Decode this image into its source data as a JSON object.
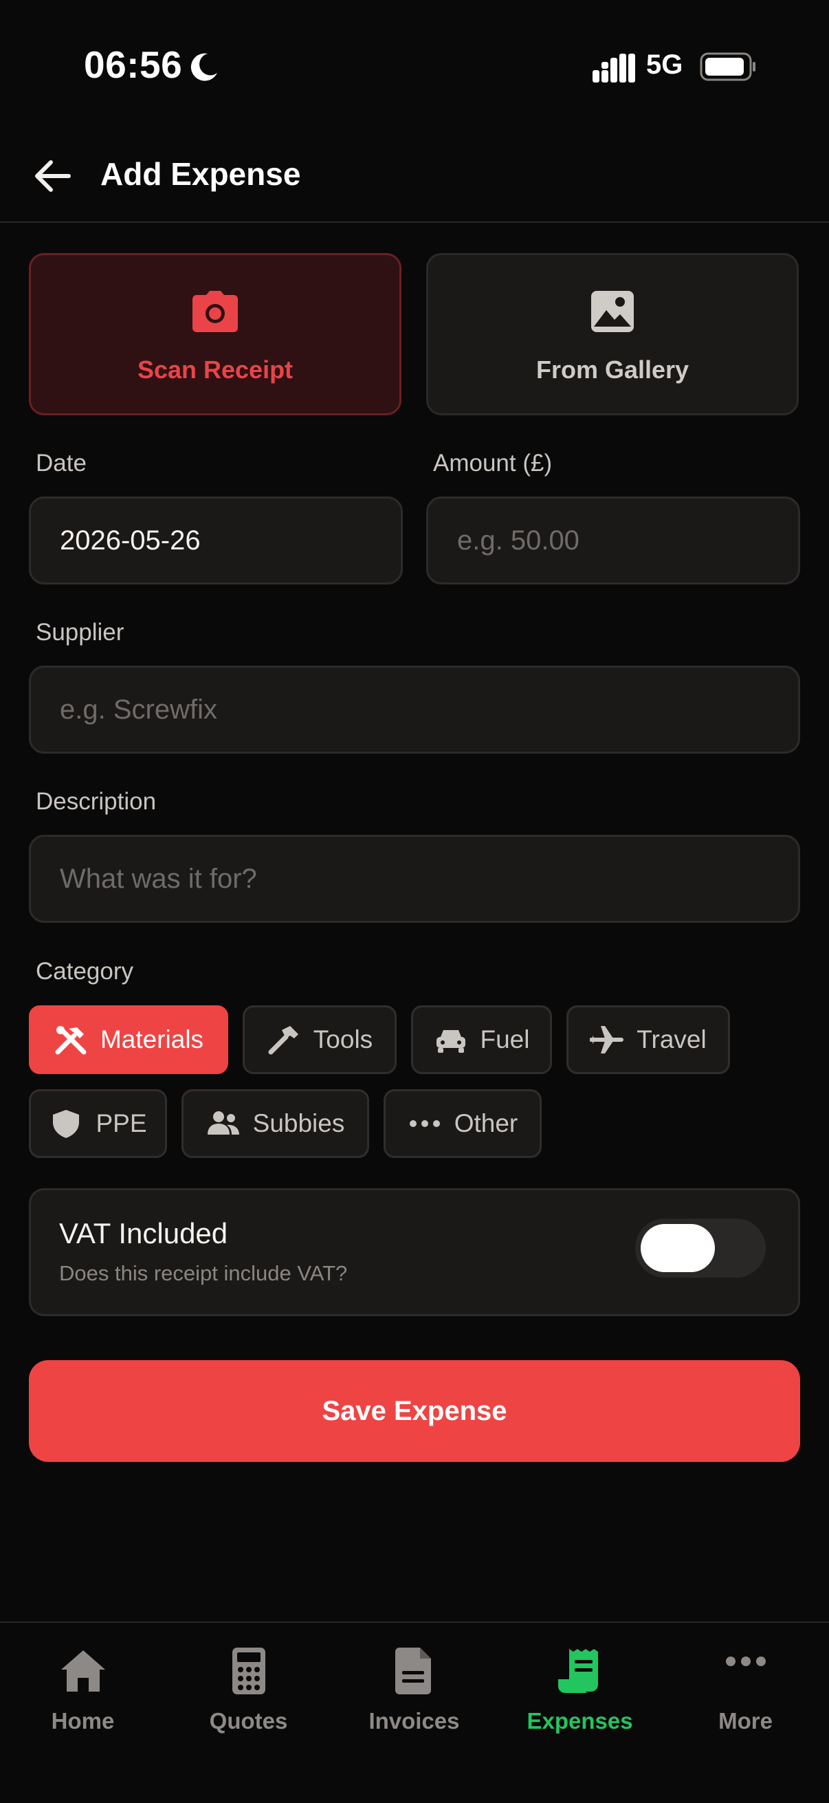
{
  "status_bar": {
    "time": "06:56",
    "network": "5G"
  },
  "header": {
    "title": "Add Expense"
  },
  "receipt": {
    "scan_label": "Scan Receipt",
    "gallery_label": "From Gallery"
  },
  "form": {
    "date": {
      "label": "Date",
      "value": "2026-05-26"
    },
    "amount": {
      "label": "Amount (£)",
      "placeholder": "e.g. 50.00"
    },
    "supplier": {
      "label": "Supplier",
      "placeholder": "e.g. Screwfix"
    },
    "description": {
      "label": "Description",
      "placeholder": "What was it for?"
    }
  },
  "category": {
    "label": "Category",
    "selected": "Materials",
    "items": [
      {
        "label": "Materials",
        "icon": "tools-crossed-icon"
      },
      {
        "label": "Tools",
        "icon": "hammer-icon"
      },
      {
        "label": "Fuel",
        "icon": "car-icon"
      },
      {
        "label": "Travel",
        "icon": "plane-icon"
      },
      {
        "label": "PPE",
        "icon": "shield-icon"
      },
      {
        "label": "Subbies",
        "icon": "people-icon"
      },
      {
        "label": "Other",
        "icon": "ellipsis-icon"
      }
    ]
  },
  "vat": {
    "title": "VAT Included",
    "subtitle": "Does this receipt include VAT?",
    "enabled": false
  },
  "save_label": "Save Expense",
  "nav": {
    "active": "Expenses",
    "items": [
      {
        "label": "Home",
        "icon": "home-icon"
      },
      {
        "label": "Quotes",
        "icon": "calculator-icon"
      },
      {
        "label": "Invoices",
        "icon": "document-icon"
      },
      {
        "label": "Expenses",
        "icon": "receipt-icon"
      },
      {
        "label": "More",
        "icon": "more-icon"
      }
    ]
  },
  "colors": {
    "accent": "#ef4444",
    "nav_active": "#22c55e",
    "background": "#0a0909",
    "surface": "#1b1918"
  }
}
